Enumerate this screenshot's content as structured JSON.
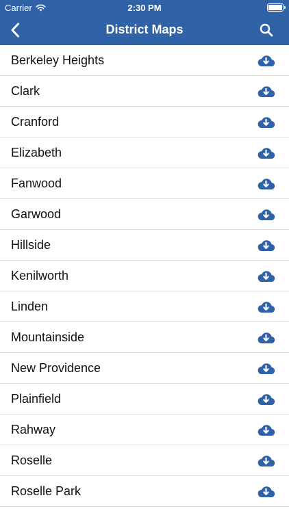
{
  "status_bar": {
    "carrier": "Carrier",
    "time": "2:30 PM"
  },
  "nav": {
    "title": "District Maps",
    "back_icon": "chevron-left-icon",
    "search_icon": "search-icon"
  },
  "colors": {
    "nav_background": "#2f62a6",
    "icon_accent": "#2f62a6",
    "separator": "#dcdcdc"
  },
  "district_list": {
    "row_icon": "cloud-download-icon",
    "items": [
      {
        "label": "Berkeley Heights"
      },
      {
        "label": "Clark"
      },
      {
        "label": "Cranford"
      },
      {
        "label": "Elizabeth"
      },
      {
        "label": "Fanwood"
      },
      {
        "label": "Garwood"
      },
      {
        "label": "Hillside"
      },
      {
        "label": "Kenilworth"
      },
      {
        "label": "Linden"
      },
      {
        "label": "Mountainside"
      },
      {
        "label": "New Providence"
      },
      {
        "label": "Plainfield"
      },
      {
        "label": "Rahway"
      },
      {
        "label": "Roselle"
      },
      {
        "label": "Roselle Park"
      }
    ]
  }
}
